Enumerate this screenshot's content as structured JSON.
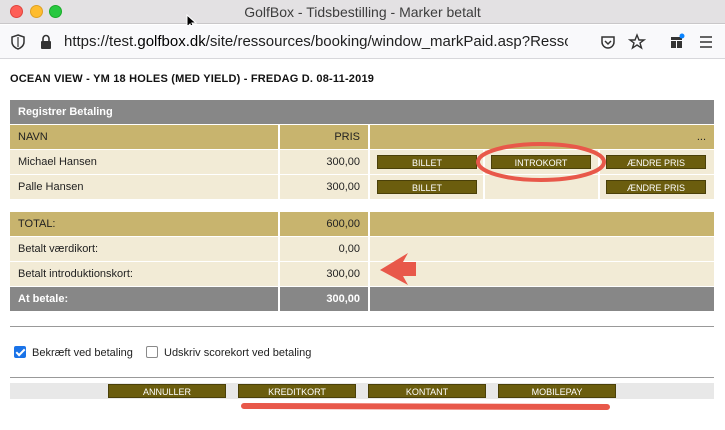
{
  "window": {
    "title": "GolfBox - Tidsbestilling - Marker betalt"
  },
  "browser": {
    "url_prefix": "https://test.",
    "url_host": "golfbox.dk",
    "url_rest": "/site/ressources/booking/window_markPaid.asp?Ressour"
  },
  "page": {
    "heading": "OCEAN VIEW - YM 18 HOLES (MED YIELD) - FREDAG D. 08-11-2019",
    "section_title": "Registrer Betaling",
    "columns": {
      "name": "NAVN",
      "price": "PRIS",
      "more": "..."
    },
    "players": [
      {
        "name": "Michael Hansen",
        "price": "300,00",
        "btn_ticket": "BILLET",
        "btn_intro": "INTROKORT",
        "btn_change": "ÆNDRE PRIS"
      },
      {
        "name": "Palle Hansen",
        "price": "300,00",
        "btn_ticket": "BILLET",
        "btn_change": "ÆNDRE PRIS"
      }
    ],
    "totals": [
      {
        "label": "TOTAL:",
        "value": "600,00"
      },
      {
        "label": "Betalt værdikort:",
        "value": "0,00"
      },
      {
        "label": "Betalt introduktionskort:",
        "value": "300,00"
      }
    ],
    "to_pay": {
      "label": "At betale:",
      "value": "300,00"
    },
    "options": [
      {
        "label": "Bekræft ved betaling",
        "checked": true
      },
      {
        "label": "Udskriv scorekort ved betaling",
        "checked": false
      }
    ],
    "actions": {
      "cancel": "ANNULLER",
      "card": "KREDITKORT",
      "cash": "KONTANT",
      "mobilepay": "MOBILEPAY"
    }
  },
  "colors": {
    "header_gray": "#878787",
    "gold": "#c8b46e",
    "cream": "#f2ebd6",
    "button": "#6b5d0e",
    "annotation": "#e8584a"
  }
}
